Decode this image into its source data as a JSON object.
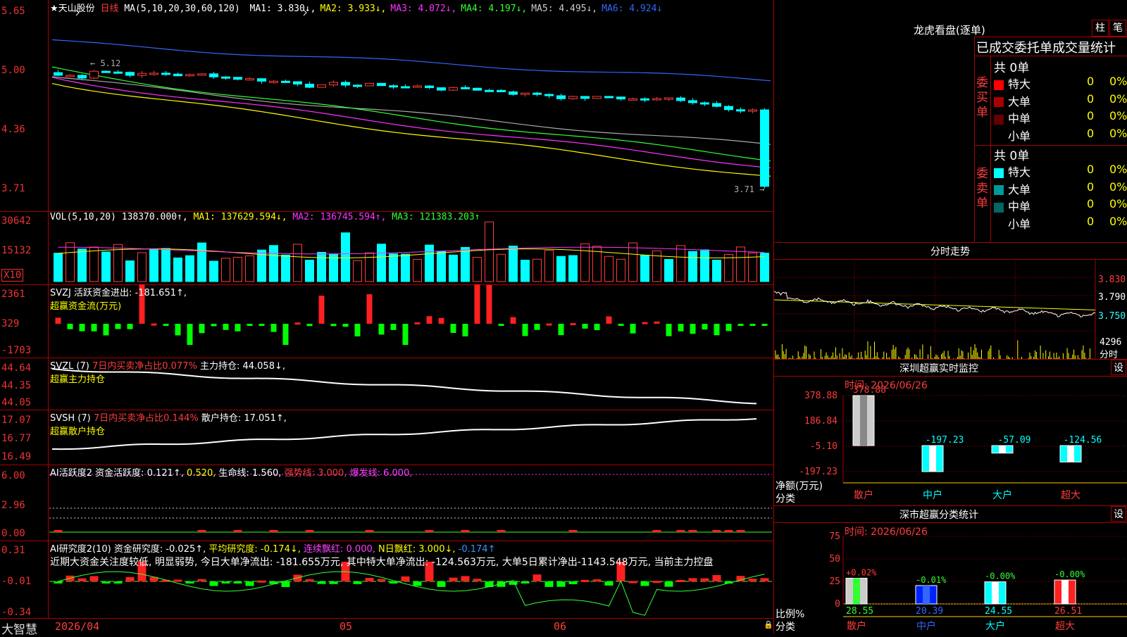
{
  "stock": {
    "name": "★天山股份",
    "period": "日线"
  },
  "price_pane": {
    "ma_label": "MA(5,10,20,30,60,120)",
    "ma_items": [
      {
        "text": "MA1: 3.830↓,",
        "color": "#ffffff"
      },
      {
        "text": "MA2: 3.933↓,",
        "color": "#ffff00"
      },
      {
        "text": "MA3: 4.072↓,",
        "color": "#ff33ff"
      },
      {
        "text": "MA4: 4.197↓,",
        "color": "#33ff33"
      },
      {
        "text": "MA5: 4.495↓,",
        "color": "#cccccc"
      },
      {
        "text": "MA6: 4.924↓",
        "color": "#3366ff"
      }
    ],
    "yticks": [
      "5.65",
      "5.00",
      "4.36",
      "3.71"
    ],
    "high_label": "5.12",
    "low_label": "3.71"
  },
  "vol_pane": {
    "label": "VOL(5,10,20)",
    "value": "138370.000↑,",
    "ma1": "MA1: 137629.594↓,",
    "ma2": "MA2: 136745.594↑,",
    "ma3": "MA3: 121383.203↑",
    "yticks": [
      "30642",
      "15132"
    ],
    "unit": "X10"
  },
  "svzj_pane": {
    "label": "SVZJ",
    "text": "活跃资金进出: -181.651↑,",
    "sub": "超赢资金流(万元)",
    "yticks": [
      "2361",
      "329",
      "-1703"
    ]
  },
  "svzl_pane": {
    "label": "SVZL (7)",
    "text1": "7日内买卖净占比0.077%",
    "text2": "主力持仓: 44.058↓,",
    "sub": "超赢主力持仓",
    "yticks": [
      "44.64",
      "44.35",
      "44.05"
    ]
  },
  "svsh_pane": {
    "label": "SVSH (7)",
    "text1": "7日内买卖净占比0.144%",
    "text2": "散户持仓: 17.051↑,",
    "sub": "超赢散户持仓",
    "yticks": [
      "17.07",
      "16.77",
      "16.49"
    ]
  },
  "ai_active_pane": {
    "label": "AI活跃度2",
    "t1": "资金活跃度: 0.121↑,",
    "t2": "0.520,",
    "t3": "生命线: 1.560,",
    "t4": "强势线: 3.000,",
    "t5": "爆发线: 6.000,",
    "yticks": [
      "6.00",
      "2.96",
      "0.00"
    ]
  },
  "ai_research_pane": {
    "label": "AI研究度2(10)",
    "t1": "资金研究度: -0.025↑,",
    "t2": "平均研究度: -0.174↓,",
    "t3": "连续飘红: 0.000,",
    "t4": "N日飘红: 3.000↓,",
    "t5": "-0.174↑",
    "comment": "近期大资金关注度较低, 明显弱势, 今日大单净流出: -181.655万元, 其中特大单净流出: -124.563万元, 大单5日累计净出-1143.548万元, 当前主力控盘",
    "yticks": [
      "0.31",
      "-0.01",
      "-0.34"
    ]
  },
  "date_axis": {
    "start": "2026/04",
    "m5": "05",
    "m6": "06"
  },
  "footer": {
    "brand": "大智慧"
  },
  "right": {
    "lhb_title": "龙虎看盘(逐单)",
    "tab1": "柱",
    "tab2": "笔",
    "section_title": "已成交委托单成交量统计",
    "buy_side": "委买单",
    "sell_side": "委卖单",
    "buy_total": "共 0单",
    "sell_total": "共 0单",
    "buy_rows": [
      {
        "label": "特大",
        "count": "0",
        "pct": "0%",
        "color": "#ff0000"
      },
      {
        "label": "大单",
        "count": "0",
        "pct": "0%",
        "color": "#aa0000"
      },
      {
        "label": "中单",
        "count": "0",
        "pct": "0%",
        "color": "#660000"
      },
      {
        "label": "小单",
        "count": "0",
        "pct": "0%",
        "color": ""
      }
    ],
    "sell_rows": [
      {
        "label": "特大",
        "count": "0",
        "pct": "0%",
        "color": "#00ffff"
      },
      {
        "label": "大单",
        "count": "0",
        "pct": "0%",
        "color": "#009999"
      },
      {
        "label": "中单",
        "count": "0",
        "pct": "0%",
        "color": "#006666"
      },
      {
        "label": "小单",
        "count": "0",
        "pct": "0%",
        "color": ""
      }
    ],
    "intraday_title": "分时走势",
    "intraday_yticks": [
      "3.830",
      "3.790",
      "3.750",
      "4296"
    ],
    "intraday_vol_label": "分时",
    "sz_title": "深圳超赢实时监控",
    "sz_time": "时间: 2026/06/26",
    "sz_set": "设",
    "sz_yticks": [
      "378.88",
      "186.84",
      "-5.10",
      "-197.23"
    ],
    "sz_ylabel1": "净额(万元)",
    "sz_ylabel2": "分类",
    "sz_cats": [
      "散户",
      "中户",
      "大户",
      "超大"
    ],
    "sz_values": [
      "378.88",
      "-197.23",
      "-57.09",
      "-124.56"
    ],
    "cls_title": "深市超赢分类统计",
    "cls_time": "时间: 2026/06/26",
    "cls_set": "设",
    "cls_yticks": [
      "75",
      "50",
      "25",
      "0"
    ],
    "cls_ylabel1": "比例%",
    "cls_ylabel2": "分类",
    "cls_cats": [
      "散户",
      "中户",
      "大户",
      "超大"
    ],
    "cls_top": [
      "+0.02%",
      "-0.01%",
      "-0.00%",
      "-0.00%"
    ],
    "cls_values": [
      "28.55",
      "20.39",
      "24.55",
      "26.51"
    ]
  },
  "chart_data": [
    {
      "type": "bar",
      "title": "深圳超赢实时监控",
      "ylabel": "净额(万元)",
      "categories": [
        "散户",
        "中户",
        "大户",
        "超大"
      ],
      "values": [
        378.88,
        -197.23,
        -57.09,
        -124.56
      ],
      "ylim": [
        -197.23,
        378.88
      ]
    },
    {
      "type": "bar",
      "title": "深市超赢分类统计",
      "ylabel": "比例%",
      "categories": [
        "散户",
        "中户",
        "大户",
        "超大"
      ],
      "values": [
        28.55,
        20.39,
        24.55,
        26.51
      ],
      "ylim": [
        0,
        75
      ]
    },
    {
      "type": "line",
      "title": "天山股份 日线 MA",
      "series": [
        {
          "name": "MA1",
          "values": [
            3.83
          ]
        },
        {
          "name": "MA2",
          "values": [
            3.933
          ]
        },
        {
          "name": "MA3",
          "values": [
            4.072
          ]
        },
        {
          "name": "MA4",
          "values": [
            4.197
          ]
        },
        {
          "name": "MA5",
          "values": [
            4.495
          ]
        },
        {
          "name": "MA6",
          "values": [
            4.924
          ]
        }
      ]
    }
  ]
}
